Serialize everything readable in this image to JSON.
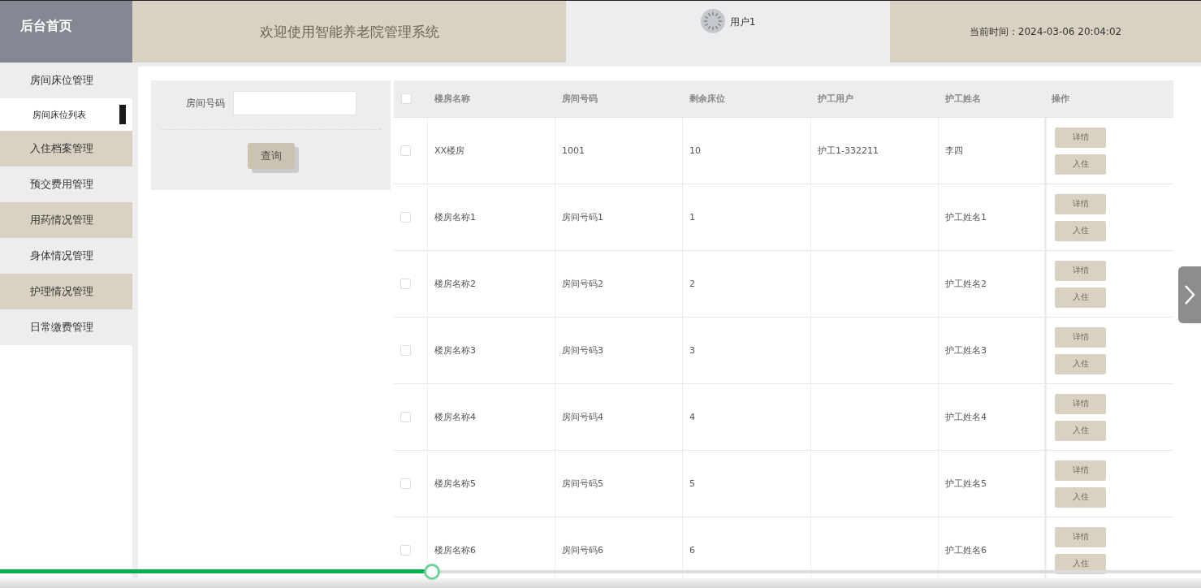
{
  "header": {
    "home": "后台首页",
    "title": "欢迎使用智能养老院管理系统",
    "user": "用户1",
    "time": "当前时间：2024-03-06 20:04:02"
  },
  "sidebar": {
    "items": [
      {
        "label": "房间床位管理",
        "children": [
          {
            "label": "房间床位列表",
            "selected": true
          }
        ]
      },
      {
        "label": "入住档案管理"
      },
      {
        "label": "预交费用管理"
      },
      {
        "label": "用药情况管理"
      },
      {
        "label": "身体情况管理"
      },
      {
        "label": "护理情况管理"
      },
      {
        "label": "日常缴费管理"
      }
    ]
  },
  "search": {
    "label": "房间号码",
    "button": "查询"
  },
  "table": {
    "select_all": {
      "checked": false
    },
    "columns": [
      "楼房名称",
      "房间号码",
      "剩余床位",
      "护工用户",
      "护工姓名",
      "操作"
    ],
    "rows": [
      {
        "checked": false,
        "cells": [
          "XX楼房",
          "1001",
          "10",
          "护工1-332211",
          "李四"
        ],
        "actions": [
          "详情",
          "入住"
        ]
      },
      {
        "checked": false,
        "cells": [
          "楼房名称1",
          "房间号码1",
          "1",
          "",
          "护工姓名1"
        ],
        "actions": [
          "详情",
          "入住"
        ]
      },
      {
        "checked": false,
        "cells": [
          "楼房名称2",
          "房间号码2",
          "2",
          "",
          "护工姓名2"
        ],
        "actions": [
          "详情",
          "入住"
        ]
      },
      {
        "checked": false,
        "cells": [
          "楼房名称3",
          "房间号码3",
          "3",
          "",
          "护工姓名3"
        ],
        "actions": [
          "详情",
          "入住"
        ]
      },
      {
        "checked": false,
        "cells": [
          "楼房名称4",
          "房间号码4",
          "4",
          "",
          "护工姓名4"
        ],
        "actions": [
          "详情",
          "入住"
        ]
      },
      {
        "checked": false,
        "cells": [
          "楼房名称5",
          "房间号码5",
          "5",
          "",
          "护工姓名5"
        ],
        "actions": [
          "详情",
          "入住"
        ]
      },
      {
        "checked": false,
        "cells": [
          "楼房名称6",
          "房间号码6",
          "6",
          "",
          "护工姓名6"
        ],
        "actions": [
          "详情",
          "入住"
        ]
      }
    ]
  },
  "video_progress": {
    "level": 0.36
  }
}
